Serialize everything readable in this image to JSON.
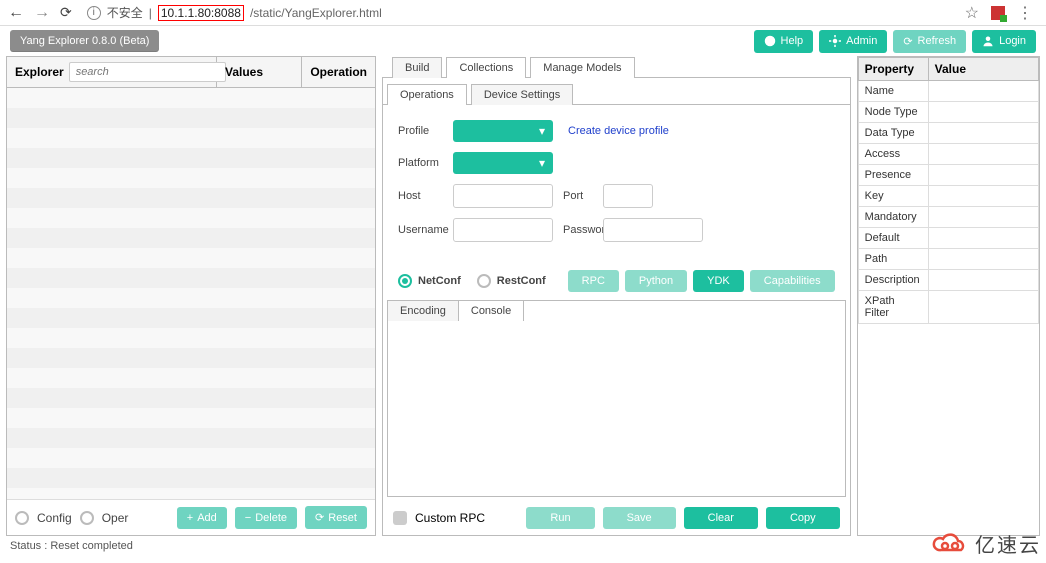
{
  "browser": {
    "insecure_label": "不安全",
    "url_host": "10.1.1.80:8088",
    "url_path": "/static/YangExplorer.html"
  },
  "toolbar": {
    "title": "Yang Explorer 0.8.0 (Beta)",
    "help": "Help",
    "admin": "Admin",
    "refresh": "Refresh",
    "login": "Login"
  },
  "left": {
    "explorer_label": "Explorer",
    "search_placeholder": "search",
    "values_label": "Values",
    "operation_label": "Operation",
    "config": "Config",
    "oper": "Oper",
    "add": "Add",
    "delete": "Delete",
    "reset": "Reset"
  },
  "center": {
    "tabs": {
      "build": "Build",
      "collections": "Collections",
      "manage": "Manage Models"
    },
    "subtabs": {
      "operations": "Operations",
      "device": "Device Settings"
    },
    "form": {
      "profile": "Profile",
      "platform": "Platform",
      "host": "Host",
      "port": "Port",
      "username": "Username",
      "password": "Password",
      "create_link": "Create device profile"
    },
    "proto": {
      "netconf": "NetConf",
      "restconf": "RestConf"
    },
    "actions": {
      "rpc": "RPC",
      "script": "Python",
      "ydk": "YDK",
      "caps": "Capabilities"
    },
    "console_tabs": {
      "encoding": "Encoding",
      "console": "Console"
    },
    "console_footer": {
      "custom": "Custom RPC",
      "run": "Run",
      "save": "Save",
      "clear": "Clear",
      "copy": "Copy"
    }
  },
  "right": {
    "header_prop": "Property",
    "header_val": "Value",
    "rows": [
      "Name",
      "Node Type",
      "Data Type",
      "Access",
      "Presence",
      "Key",
      "Mandatory",
      "Default",
      "Path",
      "Description",
      "XPath Filter"
    ]
  },
  "status": "Status : Reset completed",
  "watermark": "亿速云"
}
